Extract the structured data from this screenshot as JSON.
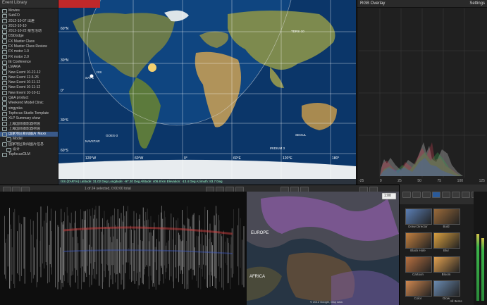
{
  "sidebar": {
    "title": "Event Library",
    "items": [
      {
        "label": "Movies",
        "sel": false,
        "ind": false
      },
      {
        "label": "SubFO",
        "sel": false,
        "ind": false
      },
      {
        "label": "2012-10-07 出差",
        "sel": false,
        "ind": false
      },
      {
        "label": "2012-10-10",
        "sel": false,
        "ind": false
      },
      {
        "label": "2012-10-22 报告活动",
        "sel": false,
        "ind": false
      },
      {
        "label": "DSDodge",
        "sel": false,
        "ind": false
      },
      {
        "label": "FX Master Class",
        "sel": false,
        "ind": false
      },
      {
        "label": "FX Master Class Review",
        "sel": false,
        "ind": false
      },
      {
        "label": "FX motor 1.0",
        "sel": false,
        "ind": false
      },
      {
        "label": "FX motor 2.0",
        "sel": false,
        "ind": false
      },
      {
        "label": "IE Conference",
        "sel": false,
        "ind": false
      },
      {
        "label": "LMAKA",
        "sel": false,
        "ind": false
      },
      {
        "label": "New Event 10-22-12",
        "sel": false,
        "ind": false
      },
      {
        "label": "New Event 12-6-26",
        "sel": false,
        "ind": false
      },
      {
        "label": "New Event 10-11-12",
        "sel": false,
        "ind": false
      },
      {
        "label": "New Event 10-11-12",
        "sel": false,
        "ind": false
      },
      {
        "label": "New Event 10-10-11",
        "sel": false,
        "ind": false
      },
      {
        "label": "Q&A product",
        "sel": false,
        "ind": false
      },
      {
        "label": "Weekend Model Clinic",
        "sel": false,
        "ind": false
      },
      {
        "label": "xingyoka",
        "sel": false,
        "ind": false
      },
      {
        "label": "Topfocus Studio Template",
        "sel": false,
        "ind": false
      },
      {
        "label": "XLP Summary show",
        "sel": false,
        "ind": false
      },
      {
        "label": "上海国际摄影器材展",
        "sel": false,
        "ind": false
      },
      {
        "label": "上海国际摄影器材展",
        "sel": false,
        "ind": false
      },
      {
        "label": "国家地区新闻图片 Maxx",
        "sel": true,
        "ind": false
      },
      {
        "label": "Model",
        "sel": false,
        "ind": true
      },
      {
        "label": "国家地区新闻图片信息",
        "sel": false,
        "ind": false
      },
      {
        "label": "设计",
        "sel": false,
        "ind": true
      },
      {
        "label": "TopfocusOLM",
        "sel": false,
        "ind": false
      }
    ]
  },
  "map": {
    "lat_labels": [
      "60°N",
      "30°N",
      "0°",
      "30°S",
      "60°S"
    ],
    "lon_labels": [
      "120°W",
      "60°W",
      "0°",
      "60°E",
      "120°E",
      "180°"
    ],
    "satellites": [
      "ISS",
      "SAT-1",
      "GOES-3",
      "NAVSTAR",
      "SEOUL",
      "IRIDIUM 3",
      "TDRS-10"
    ],
    "status": "ISS (ZARYA) Latitude: 31.02 Deg  Longitude: -97.20 Deg  Altitude: 406.8 km  Elevation: -13.4 Deg  Azimuth: 83.7 Deg"
  },
  "rgb_overlay": {
    "title": "RGB Overlay",
    "settings": "Settings",
    "ticks": [
      "-25",
      "0",
      "25",
      "50",
      "75",
      "100",
      "125"
    ]
  },
  "timeline_toolbar": {
    "info": "1 of 24 selected, 0:00:00 total"
  },
  "viewer": {
    "labels": [
      "EUROPE",
      "AFRICA"
    ],
    "corner": "1:00",
    "copyright": "© 2012 Google, Map data"
  },
  "effects": {
    "items": [
      {
        "label": "Draw Director",
        "color": "#5b7fb5"
      },
      {
        "label": "Bold",
        "color": "#9a6a3a"
      },
      {
        "label": "Black Hole",
        "color": "#c28040"
      },
      {
        "label": "Blur",
        "color": "#d9a040"
      },
      {
        "label": "Cartoon",
        "color": "#b87040"
      },
      {
        "label": "Bloom",
        "color": "#e0a050"
      },
      {
        "label": "Color",
        "color": "#d08850"
      },
      {
        "label": "Glow",
        "color": "#6a8ab0"
      },
      {
        "label": "All Items",
        "color": "#444"
      }
    ],
    "count": "All Items"
  },
  "colors": {
    "map_ocean": "#0d3a6e",
    "selection": "#3a5a8a",
    "accent_red": "#c0282a"
  }
}
